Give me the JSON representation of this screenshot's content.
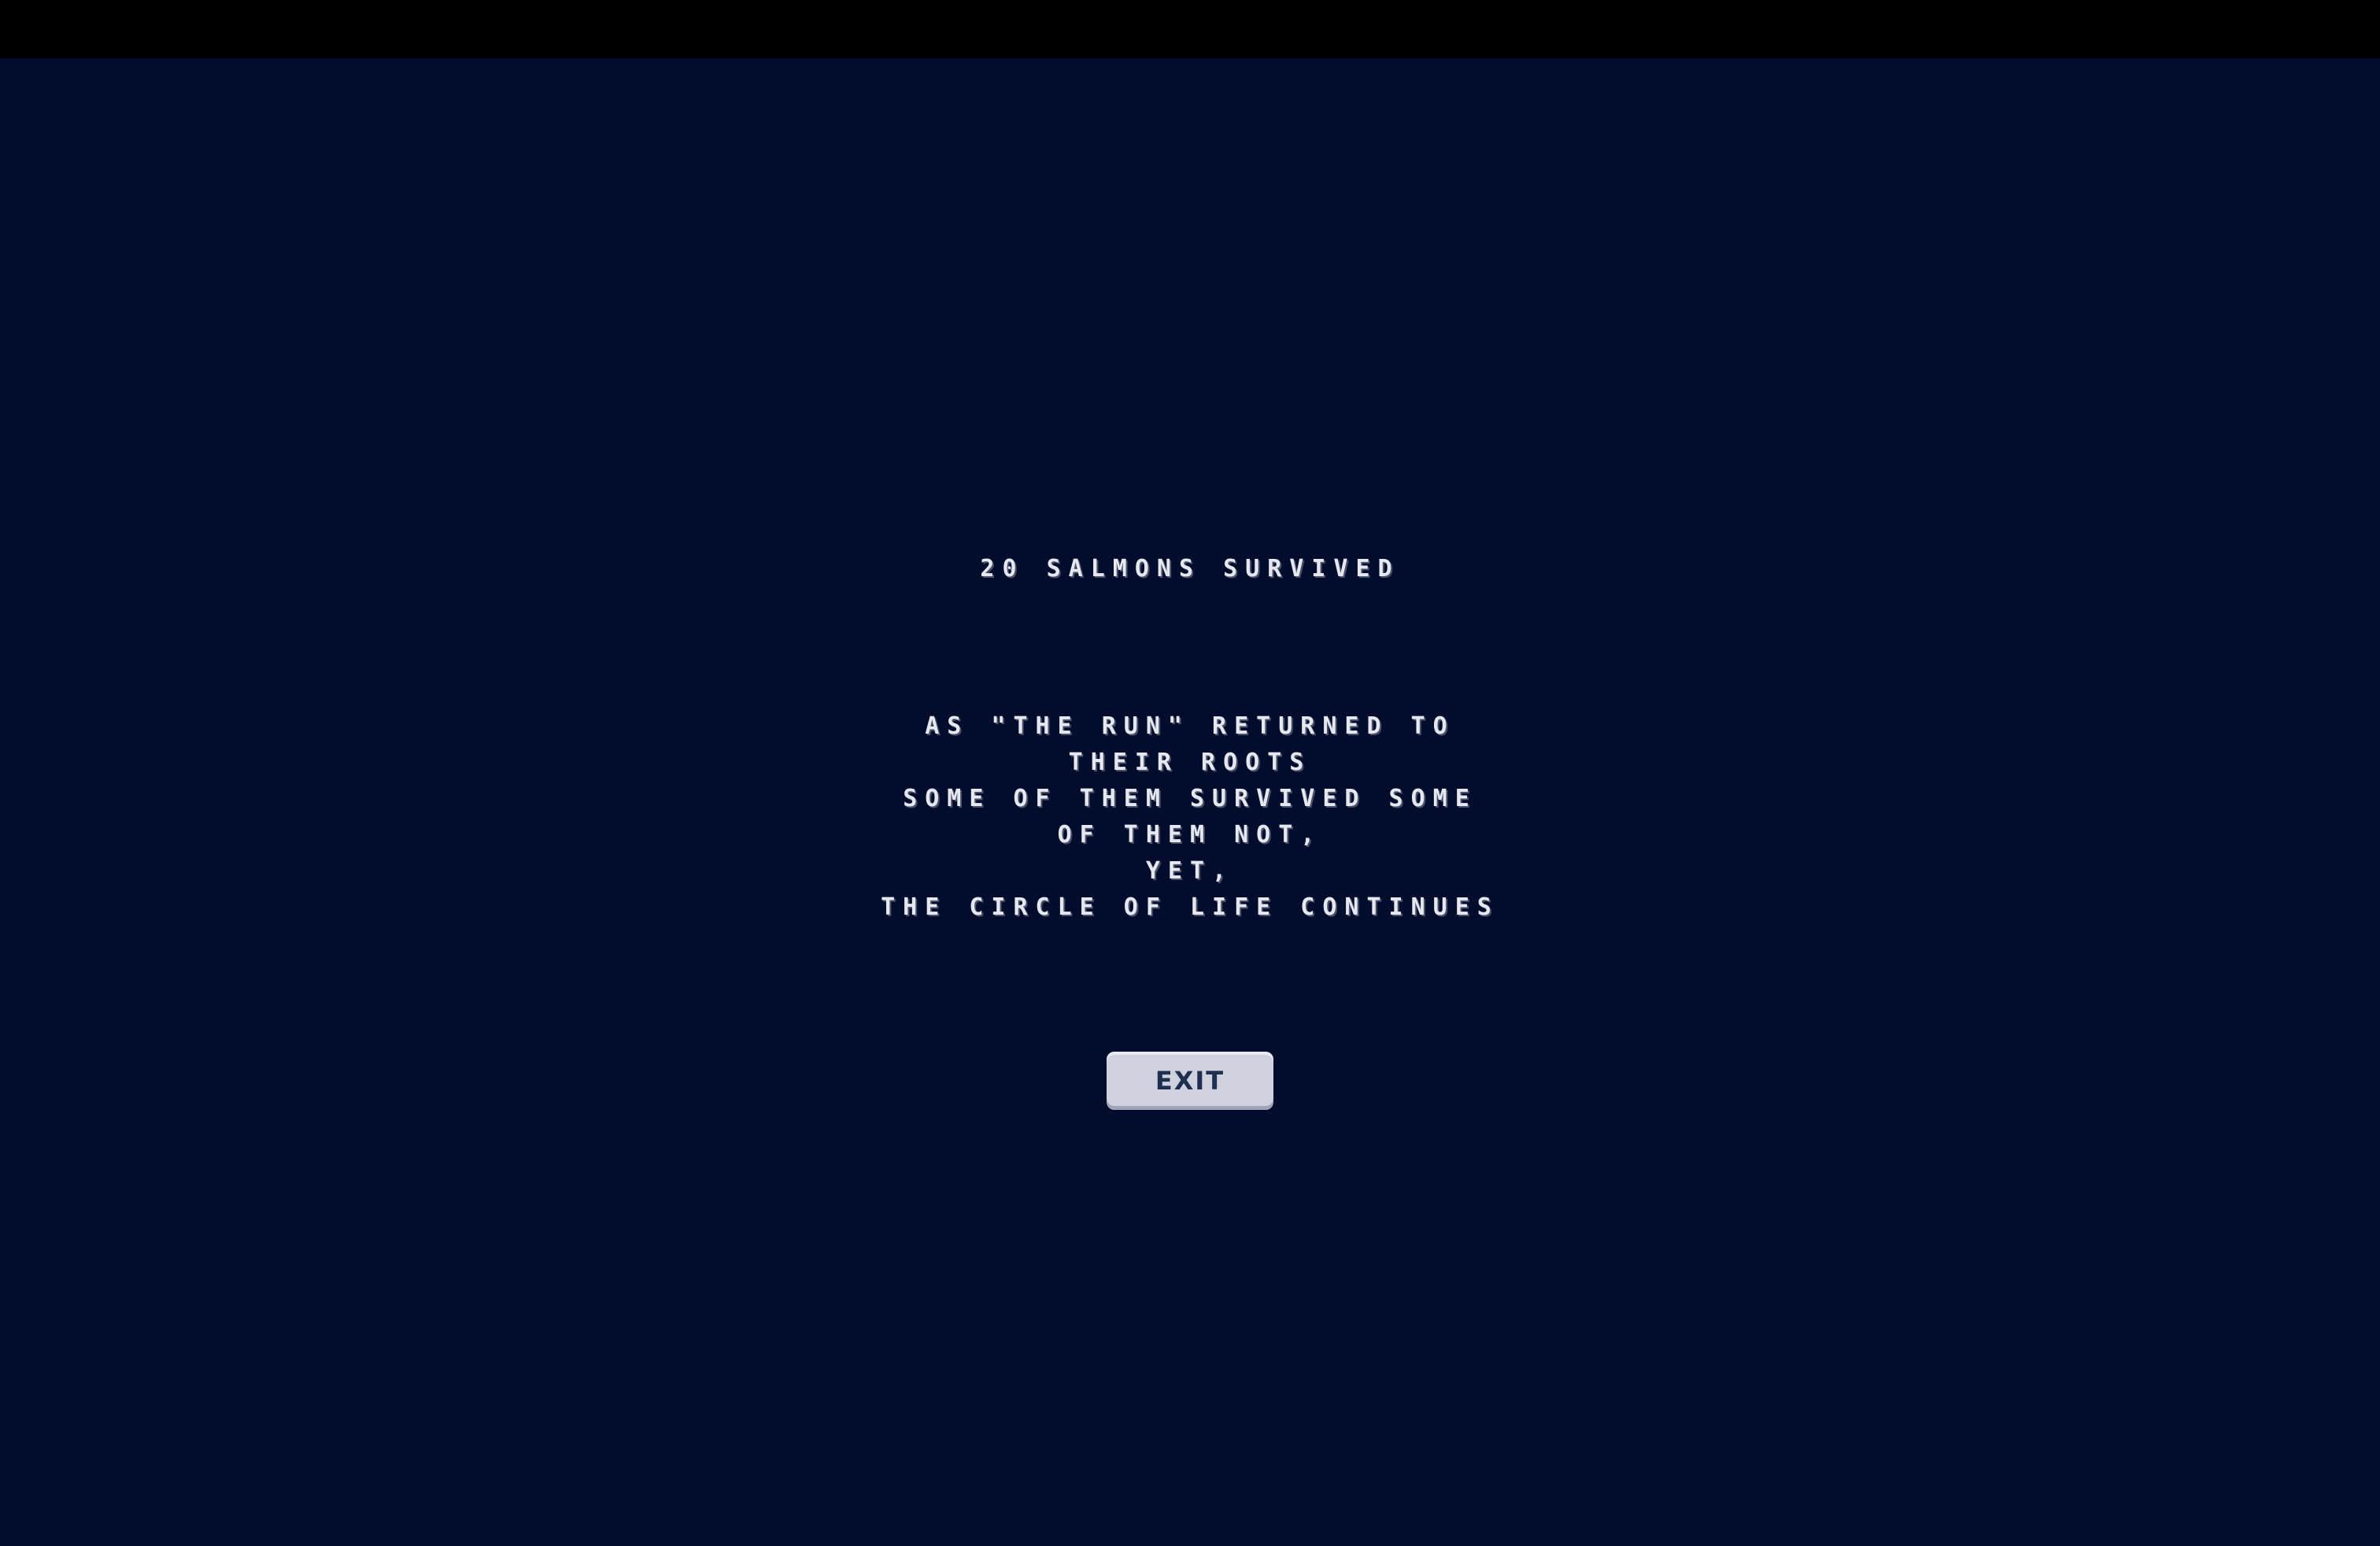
{
  "end_screen": {
    "survivors_text": "20 SALMONS SURVIVED",
    "message_lines": [
      "AS \"THE RUN\" RETURNED TO THEIR ROOTS",
      "SOME OF THEM SURVIVED SOME OF THEM NOT,",
      "YET,",
      "THE CIRCLE OF LIFE CONTINUES"
    ],
    "exit_label": "EXIT"
  },
  "colors": {
    "background": "#020c2c",
    "top_bar": "#000000",
    "text": "#e6e8f0",
    "button_fill": "#cfd2de",
    "button_text": "#1e2f4f"
  }
}
